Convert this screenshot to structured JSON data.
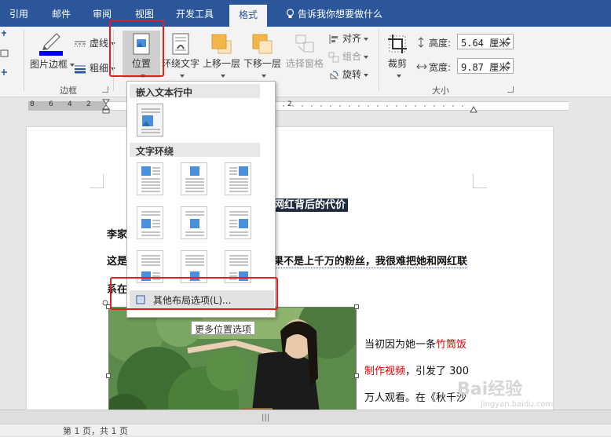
{
  "tabs": [
    {
      "label": "引用",
      "active": false
    },
    {
      "label": "邮件",
      "active": false
    },
    {
      "label": "审阅",
      "active": false
    },
    {
      "label": "视图",
      "active": false
    },
    {
      "label": "开发工具",
      "active": false
    },
    {
      "label": "格式",
      "active": true
    }
  ],
  "tellme": "告诉我你想要做什么",
  "ribbon": {
    "border_group": {
      "label": "边框",
      "picture_border": "图片边框",
      "dashes": "虚线",
      "weight": "粗细"
    },
    "arrange": {
      "position": "位置",
      "wrap_text": "环绕文字",
      "bring_forward": "上移一层",
      "send_backward": "下移一层",
      "selection_pane": "选择窗格",
      "align": "对齐",
      "group": "组合",
      "rotate": "旋转"
    },
    "size_group": {
      "label": "大小",
      "crop": "裁剪",
      "height_label": "高度:",
      "height_value": "5.64 厘米",
      "width_label": "宽度:",
      "width_value": "9.87 厘米"
    }
  },
  "ruler": {
    "numbers": [
      "8",
      "6",
      "4",
      "2",
      "2"
    ]
  },
  "document": {
    "title": "网红背后的代价",
    "line1": "李家",
    "line2_start": "这是",
    "line2_end": "果不是上千万的粉丝，我很难把她和网红联",
    "line3": "系在",
    "side1_a": "当初因为她一条",
    "side1_b": "竹筒饭",
    "side2_a": "制作视频",
    "side2_b": "，引发了 300",
    "side3": "万人观看。在《秋千沙"
  },
  "dropdown": {
    "inline_header": "嵌入文本行中",
    "wrap_header": "文字环绕",
    "more_options": "其他布局选项(L)...",
    "tooltip": "更多位置选项"
  },
  "status": {
    "text": "第 1 页，共 1 页"
  },
  "watermark": {
    "text": "Bai经验",
    "sub": "jingyan.baidu.com"
  },
  "colors": {
    "accent": "#2b579a",
    "highlight_box": "#e02020",
    "red_text": "#e60000"
  }
}
